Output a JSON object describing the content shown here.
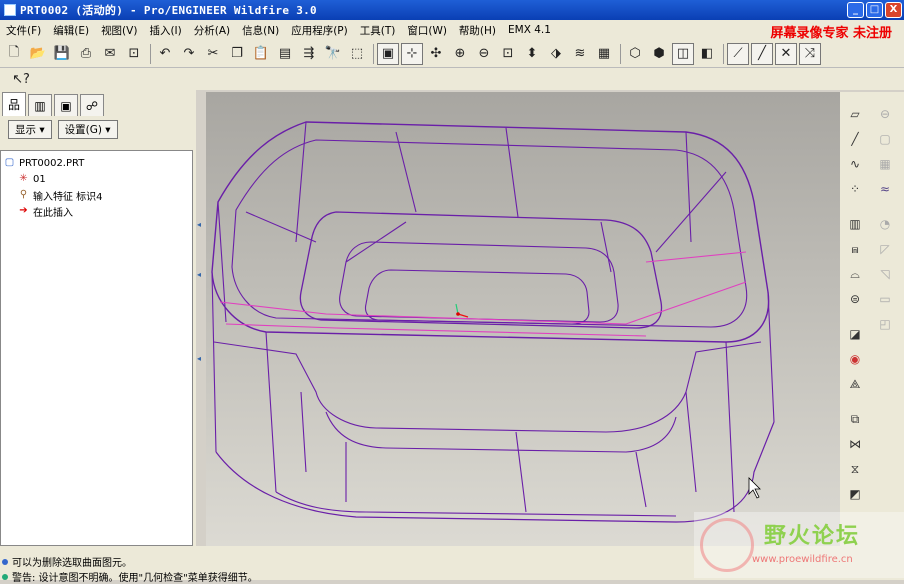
{
  "window": {
    "title": "PRT0002 (活动的) - Pro/ENGINEER Wildfire 3.0",
    "minimize": "_",
    "maximize": "□",
    "close": "X"
  },
  "menubar": {
    "items": [
      "文件(F)",
      "编辑(E)",
      "视图(V)",
      "插入(I)",
      "分析(A)",
      "信息(N)",
      "应用程序(P)",
      "工具(T)",
      "窗口(W)",
      "帮助(H)",
      "EMX 4.1"
    ]
  },
  "watermark_top": "屏幕录像专家  未注册",
  "left_panel": {
    "show_button": "显示 ▾",
    "settings_button": "设置(G) ▾",
    "tree": [
      {
        "label": "PRT0002.PRT",
        "icon": "part-icon"
      },
      {
        "label": "01",
        "icon": "datum-icon"
      },
      {
        "label": "输入特征 标识4",
        "icon": "import-feature-icon"
      },
      {
        "label": "在此插入",
        "icon": "insert-here-icon"
      }
    ]
  },
  "status": {
    "line1": "可以为删除选取曲面图元。",
    "line2": "警告: 设计意图不明确。使用\"几何检查\"菜单获得细节。"
  },
  "forum_watermark": {
    "name": "野火论坛",
    "url": "www.proewildfire.cn"
  },
  "colors": {
    "titlebar": "#0a3fb4",
    "model_edges": "#6a1fa8",
    "highlight_edges": "#e040c0",
    "watermark_red": "#ee0000"
  }
}
